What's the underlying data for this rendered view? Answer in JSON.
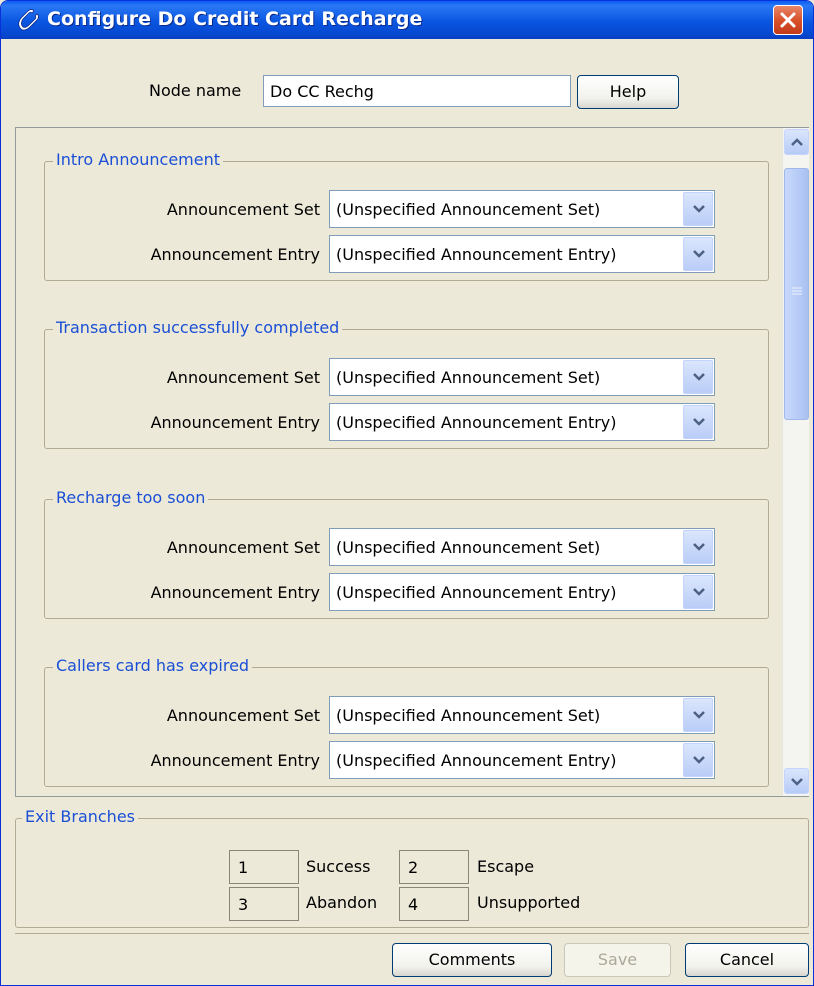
{
  "window": {
    "title": "Configure Do Credit Card Recharge",
    "title_icon": "phone-handset-icon",
    "close_icon": "close-icon",
    "colors": {
      "titlebar": "#0a55e0",
      "legend_text": "#1a4fd6",
      "close": "#d9522c"
    }
  },
  "node": {
    "label": "Node name",
    "value": "Do CC Rechg",
    "help_label": "Help"
  },
  "sections": [
    {
      "legend": "Intro Announcement",
      "set_label": "Announcement Set",
      "set_value": "(Unspecified Announcement Set)",
      "entry_label": "Announcement Entry",
      "entry_value": "(Unspecified Announcement Entry)"
    },
    {
      "legend": "Transaction successfully completed",
      "set_label": "Announcement Set",
      "set_value": "(Unspecified Announcement Set)",
      "entry_label": "Announcement Entry",
      "entry_value": "(Unspecified Announcement Entry)"
    },
    {
      "legend": "Recharge too soon",
      "set_label": "Announcement Set",
      "set_value": "(Unspecified Announcement Set)",
      "entry_label": "Announcement Entry",
      "entry_value": "(Unspecified Announcement Entry)"
    },
    {
      "legend": "Callers card has expired",
      "set_label": "Announcement Set",
      "set_value": "(Unspecified Announcement Set)",
      "entry_label": "Announcement Entry",
      "entry_value": "(Unspecified Announcement Entry)"
    }
  ],
  "exit_branches": {
    "legend": "Exit Branches",
    "items": [
      {
        "number": "1",
        "label": "Success"
      },
      {
        "number": "2",
        "label": "Escape"
      },
      {
        "number": "3",
        "label": "Abandon"
      },
      {
        "number": "4",
        "label": "Unsupported"
      }
    ]
  },
  "buttons": {
    "comments": "Comments",
    "save": "Save",
    "cancel": "Cancel"
  }
}
